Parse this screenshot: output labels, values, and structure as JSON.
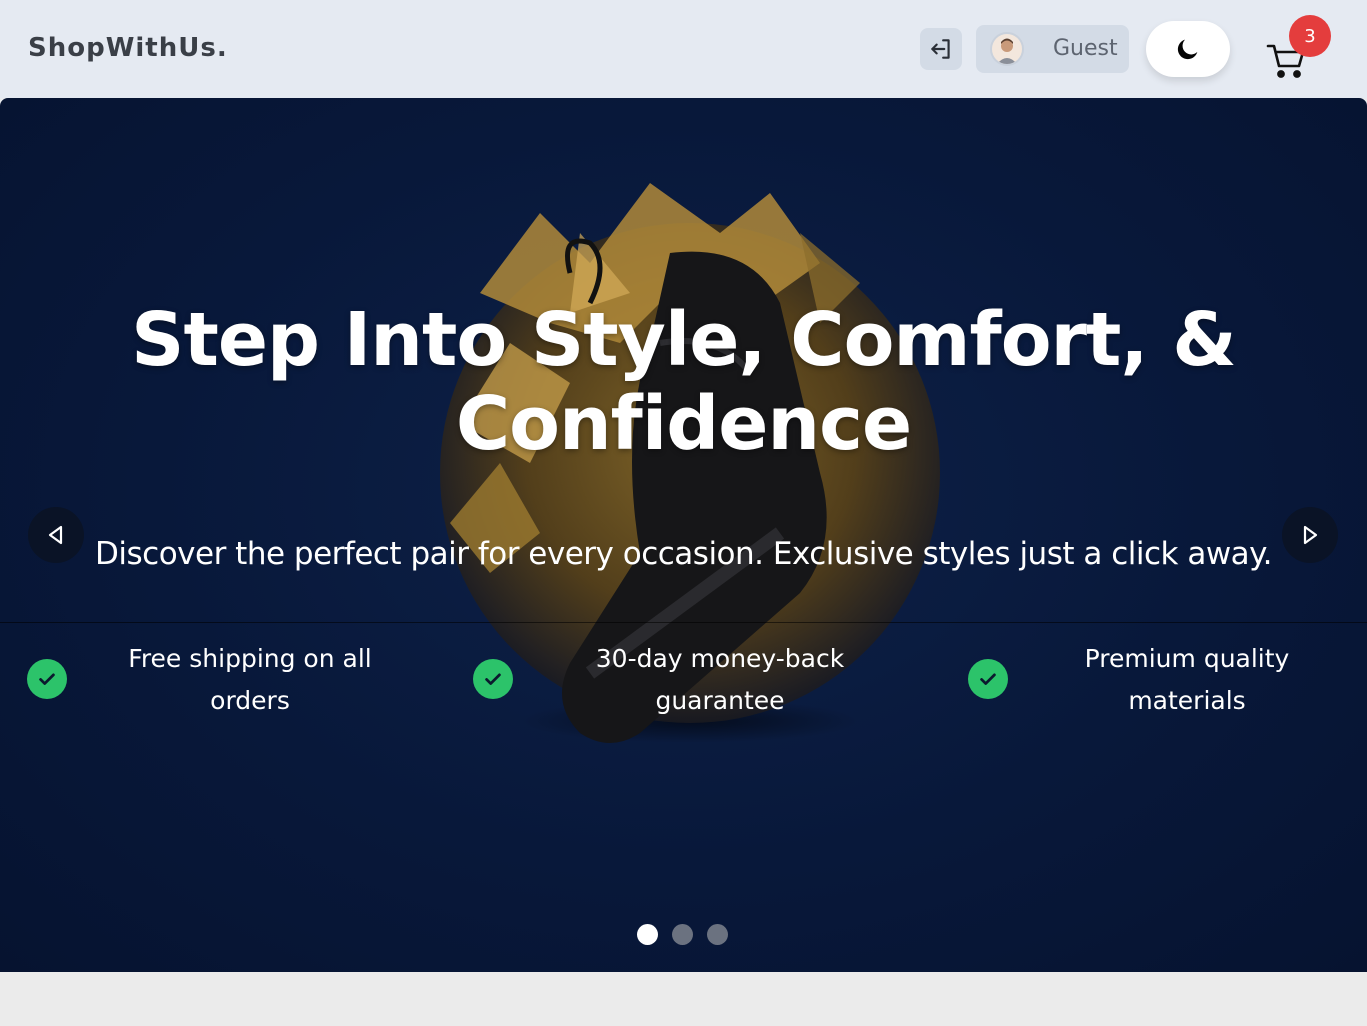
{
  "header": {
    "brand": "ShopWithUs.",
    "user_name": "Guest",
    "cart_count": "3",
    "icons": {
      "logout": "logout-icon",
      "theme": "moon-icon",
      "cart": "cart-icon",
      "avatar": "avatar-icon"
    }
  },
  "hero": {
    "title": "Step Into Style, Comfort, & Confidence",
    "subtitle": "Discover the perfect pair for every occasion. Exclusive styles just a click away.",
    "features": [
      {
        "label": "Free shipping on all orders"
      },
      {
        "label": "30-day money-back guarantee"
      },
      {
        "label": "Premium quality materials"
      }
    ],
    "carousel": {
      "slide_count": 3,
      "active_index": 0
    }
  },
  "colors": {
    "hero_bg": "#08183a",
    "accent_check": "#2cc36a",
    "badge": "#e43d3d",
    "dot_active": "#ffffff",
    "dot_inactive": "#6b7280"
  }
}
